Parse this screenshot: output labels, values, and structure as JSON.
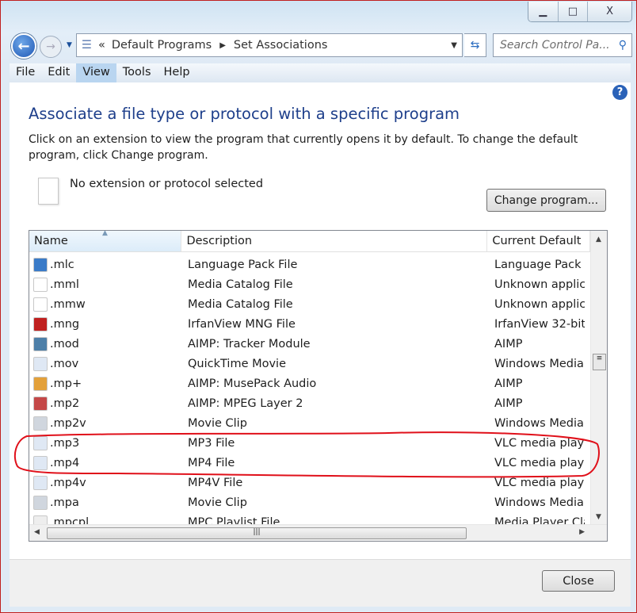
{
  "window": {
    "minimize": "▁",
    "maximize": "□",
    "close": "X"
  },
  "nav": {
    "breadcrumb": [
      "Default Programs",
      "Set Associations"
    ],
    "breadcrumb_prefix": "«",
    "search_placeholder": "Search Control Pa..."
  },
  "menu": [
    "File",
    "Edit",
    "View",
    "Tools",
    "Help"
  ],
  "main": {
    "title": "Associate a file type or protocol with a specific program",
    "description": "Click on an extension to view the program that currently opens it by default. To change the default program, click Change program.",
    "selected": "No extension or protocol selected",
    "change_button": "Change program...",
    "help": "?"
  },
  "table": {
    "columns": [
      "Name",
      "Description",
      "Current Default"
    ],
    "rows": [
      {
        "name": ".mlc",
        "description": "Language Pack File",
        "default": "Language Pack Ins",
        "icon": "globe-file-icon",
        "color": "#3a7bc8"
      },
      {
        "name": ".mml",
        "description": "Media Catalog File",
        "default": "Unknown applicat",
        "icon": "blank-file-icon",
        "color": "#ffffff"
      },
      {
        "name": ".mmw",
        "description": "Media Catalog File",
        "default": "Unknown applicat",
        "icon": "blank-file-icon",
        "color": "#ffffff"
      },
      {
        "name": ".mng",
        "description": "IrfanView MNG File",
        "default": "IrfanView 32-bit",
        "icon": "irfanview-icon",
        "color": "#c0201f"
      },
      {
        "name": ".mod",
        "description": "AIMP: Tracker Module",
        "default": "AIMP",
        "icon": "aimp-mod-icon",
        "color": "#4d7fa8"
      },
      {
        "name": ".mov",
        "description": "QuickTime Movie",
        "default": "Windows Media P",
        "icon": "media-file-icon",
        "color": "#dfe8f4"
      },
      {
        "name": ".mp+",
        "description": "AIMP: MusePack Audio",
        "default": "AIMP",
        "icon": "aimp-audio-icon",
        "color": "#e3a03a"
      },
      {
        "name": ".mp2",
        "description": "AIMP: MPEG Layer 2",
        "default": "AIMP",
        "icon": "aimp-mp2-icon",
        "color": "#c44848"
      },
      {
        "name": ".mp2v",
        "description": "Movie Clip",
        "default": "Windows Media P",
        "icon": "mpeg-file-icon",
        "color": "#d0d6de"
      },
      {
        "name": ".mp3",
        "description": "MP3 File",
        "default": "VLC media player",
        "icon": "media-file-icon",
        "color": "#dfe8f4"
      },
      {
        "name": ".mp4",
        "description": "MP4 File",
        "default": "VLC media player",
        "icon": "media-file-icon",
        "color": "#dfe8f4"
      },
      {
        "name": ".mp4v",
        "description": "MP4V File",
        "default": "VLC media player",
        "icon": "media-file-icon",
        "color": "#dfe8f4"
      },
      {
        "name": ".mpa",
        "description": "Movie Clip",
        "default": "Windows Media P",
        "icon": "mpeg-file-icon",
        "color": "#d0d6de"
      },
      {
        "name": ".mpcpl",
        "description": "MPC Playlist File",
        "default": "Media Player Class",
        "icon": "playlist-icon",
        "color": "#eeeeee"
      }
    ]
  },
  "footer": {
    "close_button": "Close"
  },
  "annotation_color": "#e0101a"
}
